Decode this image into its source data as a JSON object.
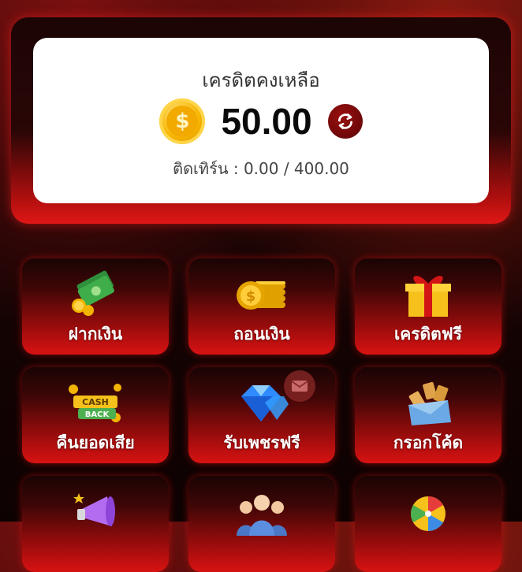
{
  "credit": {
    "title": "เครดิตคงเหลือ",
    "balance": "50.00",
    "coin_symbol": "$",
    "turnover": "ติดเทิร์น : 0.00 / 400.00"
  },
  "menu": [
    {
      "label": "ฝากเงิน",
      "icon": "cash-stack-icon"
    },
    {
      "label": "ถอนเงิน",
      "icon": "coin-stack-icon"
    },
    {
      "label": "เครดิตฟรี",
      "icon": "gift-box-icon"
    },
    {
      "label": "คืนยอดเสีย",
      "icon": "cashback-icon",
      "icon_text_1": "CASH",
      "icon_text_2": "BACK"
    },
    {
      "label": "รับเพชรฟรี",
      "icon": "diamond-icon"
    },
    {
      "label": "กรอกโค้ด",
      "icon": "envelope-tickets-icon"
    },
    {
      "label": "",
      "icon": "megaphone-icon"
    },
    {
      "label": "",
      "icon": "people-icon"
    },
    {
      "label": "",
      "icon": "prize-wheel-icon"
    }
  ],
  "colors": {
    "accent": "#d81212",
    "coin": "#f7b500",
    "background": "#1a0404"
  }
}
